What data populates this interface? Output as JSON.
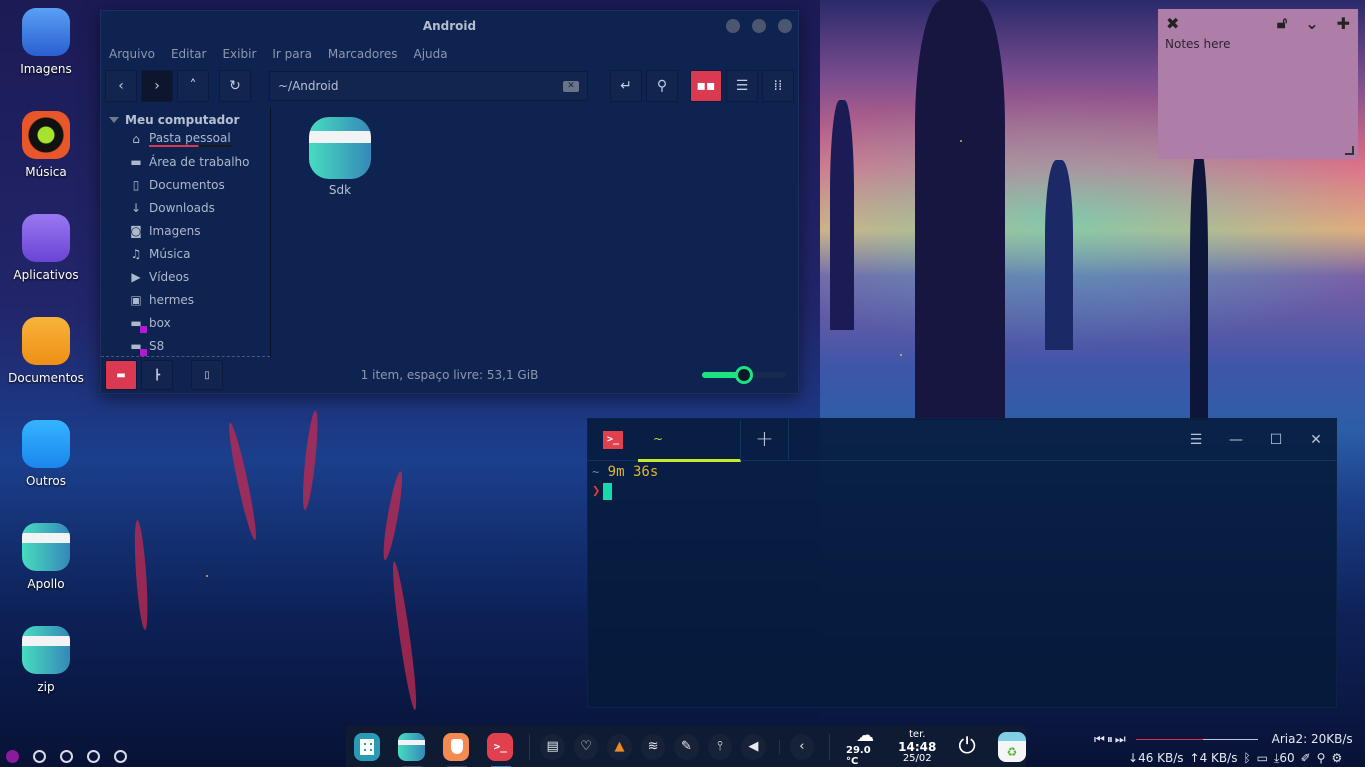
{
  "desktop": {
    "icons": [
      {
        "label": "Imagens",
        "icon": "images-folder-icon",
        "color": "#3a7be8"
      },
      {
        "label": "Música",
        "icon": "music-player-icon",
        "color": "#e8562a"
      },
      {
        "label": "Aplicativos",
        "icon": "apps-box-icon",
        "color": "#8a63e8"
      },
      {
        "label": "Documentos",
        "icon": "documents-icon",
        "color": "#f4a623"
      },
      {
        "label": "Outros",
        "icon": "pins-icon",
        "color": "#1e9cf4"
      },
      {
        "label": "Apollo",
        "icon": "folder-icon",
        "color": "#3dcab8"
      },
      {
        "label": "zip",
        "icon": "folder-icon",
        "color": "#3dcab8"
      }
    ],
    "pager": {
      "pages": 5,
      "active": 1
    }
  },
  "file_manager": {
    "title": "Android",
    "menu": [
      "Arquivo",
      "Editar",
      "Exibir",
      "Ir para",
      "Marcadores",
      "Ajuda"
    ],
    "path": "~/Android",
    "sidebar": {
      "header": "Meu computador",
      "items": [
        {
          "label": "Pasta pessoal",
          "icon": "home-icon",
          "glyph": "⌂"
        },
        {
          "label": "Área de trabalho",
          "icon": "folder-icon",
          "glyph": "▬"
        },
        {
          "label": "Documentos",
          "icon": "document-icon",
          "glyph": "▯"
        },
        {
          "label": "Downloads",
          "icon": "download-arrow-icon",
          "glyph": "↓"
        },
        {
          "label": "Imagens",
          "icon": "camera-icon",
          "glyph": "◙"
        },
        {
          "label": "Música",
          "icon": "music-note-icon",
          "glyph": "♫"
        },
        {
          "label": "Vídeos",
          "icon": "video-icon",
          "glyph": "▶"
        },
        {
          "label": "hermes",
          "icon": "network-computer-icon",
          "glyph": "▣"
        },
        {
          "label": "box",
          "icon": "folder-warning-icon",
          "glyph": "▬"
        },
        {
          "label": "S8",
          "icon": "folder-warning-icon",
          "glyph": "▬"
        }
      ]
    },
    "items": [
      {
        "name": "Sdk"
      }
    ],
    "status": "1 item, espaço livre: 53,1 GiB",
    "zoom_level": 0.5,
    "accent": "#d93a52"
  },
  "notes": {
    "text": "Notes here",
    "bg": "#ae7ea8"
  },
  "terminal": {
    "tab_label": "~",
    "prompt_dir": "~",
    "elapsed": "9m 36s",
    "prompt_char": "❯"
  },
  "dock": {
    "weather": "29.0 °C",
    "day": "ter.",
    "time": "14:48",
    "date": "25/02"
  },
  "panel": {
    "aria2": "Aria2: 20KB/s",
    "download_speed": "46 KB/s",
    "upload_speed": "4 KB/s",
    "updates": "60"
  }
}
